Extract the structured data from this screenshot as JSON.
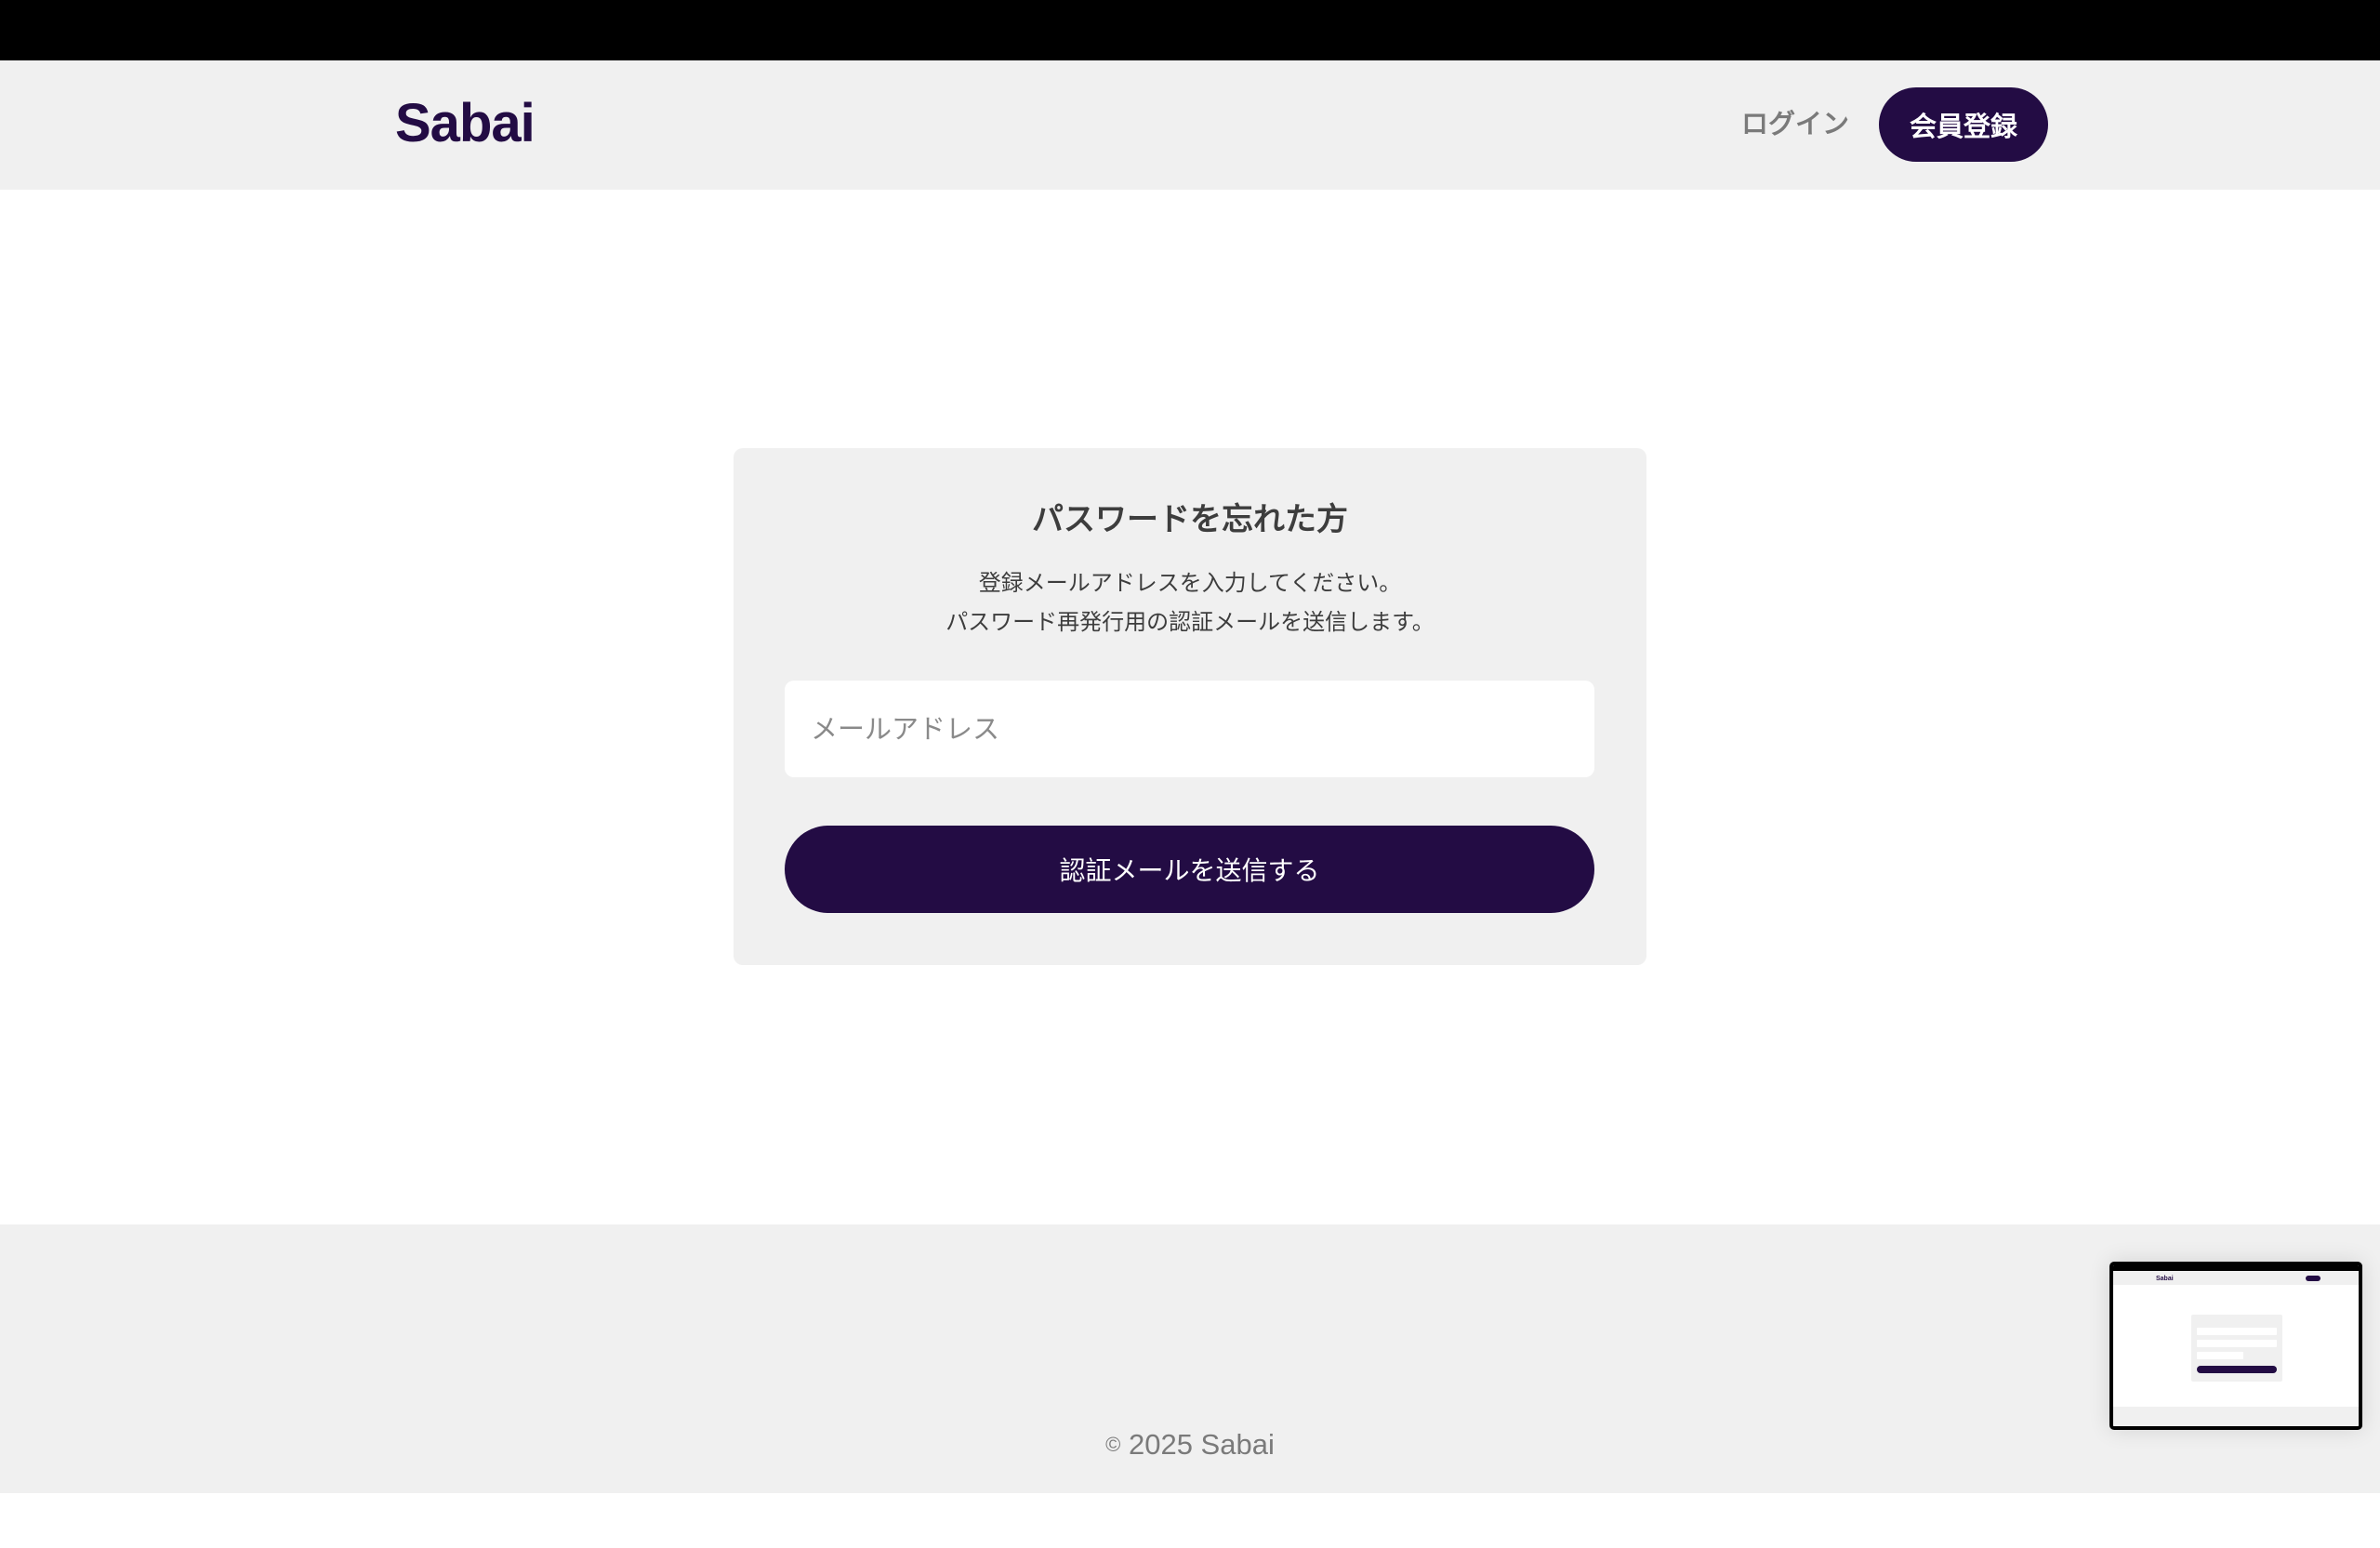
{
  "header": {
    "logo": "Sabai",
    "login_label": "ログイン",
    "register_label": "会員登録"
  },
  "card": {
    "title": "パスワードを忘れた方",
    "desc_line1": "登録メールアドレスを入力してください。",
    "desc_line2": "パスワード再発行用の認証メールを送信します。",
    "email_placeholder": "メールアドレス",
    "submit_label": "認証メールを送信する"
  },
  "footer": {
    "copyright_mark": "©",
    "copyright_text": "2025 Sabai"
  },
  "thumbnail": {
    "logo": "Sabai"
  },
  "colors": {
    "brand": "#230c44",
    "panel": "#f0f0f0",
    "text": "#3d3d3d",
    "muted": "#7a7a7a"
  }
}
